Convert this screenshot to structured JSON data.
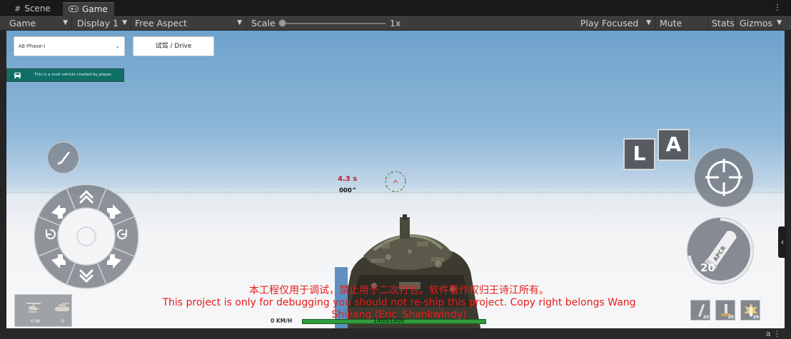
{
  "editor": {
    "tabs": [
      {
        "label": "Scene",
        "icon": "grid-icon"
      },
      {
        "label": "Game",
        "icon": "gamepad-icon"
      }
    ],
    "toolbar": {
      "view_mode": "Game",
      "display": "Display 1",
      "aspect": "Free Aspect",
      "scale_label": "Scale",
      "scale_value": "1x",
      "play_mode": "Play Focused",
      "mute_audio": "Mute Audio",
      "stats": "Stats",
      "gizmos": "Gizmos"
    }
  },
  "game_ui": {
    "vehicle_select": "AE-Phase-I",
    "drive_button": "试驾 / Drive",
    "info_banner": "This is a mod vehicle created by player.",
    "key_l": "L",
    "key_a": "A",
    "timer": "4.3 s",
    "distance": "000^",
    "warning_cn": "本工程仅用于调试，禁止用于二次打包。软件著作权归王诗江所有。",
    "warning_en": "This project is only for debugging you should not re-ship this project. Copy right belongs Wang Shijiang (Eric_Shankwindy)",
    "speed": "0 KM/H",
    "hp": "1400/1400",
    "minimap_left": "0.0K",
    "minimap_right": "0",
    "ammo_count_main": "20",
    "ammo_slots": [
      "20",
      "20",
      "20"
    ],
    "fire_shell_label": "APCR"
  },
  "colors": {
    "editor_bg": "#191919",
    "toolbar_bg": "#3c3c3c",
    "banner_bg": "#0f6f67",
    "warning_text": "#e81b1b",
    "hp_bar": "#2f9b3a",
    "timer_text": "#b4232a"
  }
}
